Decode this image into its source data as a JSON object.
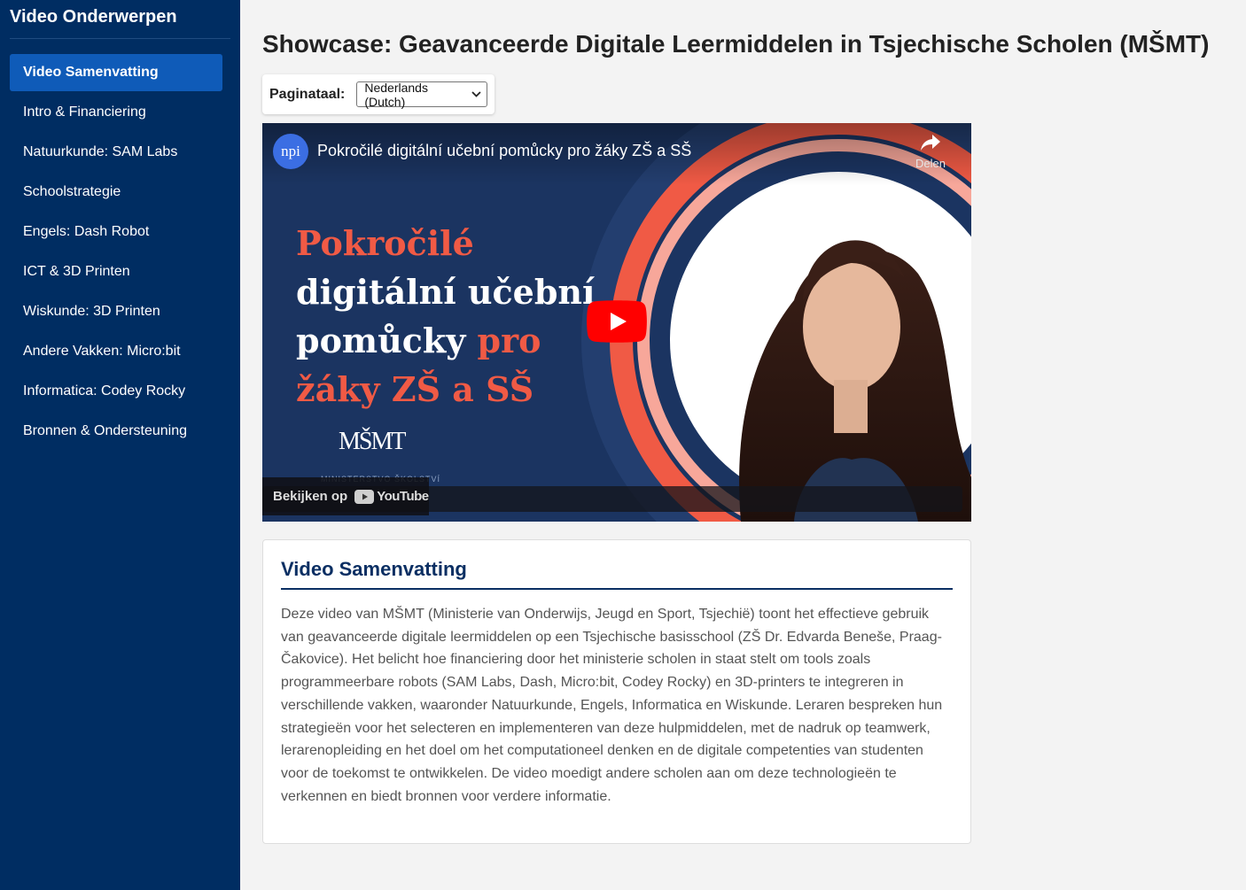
{
  "sidebar": {
    "title": "Video Onderwerpen",
    "items": [
      {
        "label": "Video Samenvatting",
        "active": true
      },
      {
        "label": "Intro & Financiering"
      },
      {
        "label": "Natuurkunde: SAM Labs"
      },
      {
        "label": "Schoolstrategie"
      },
      {
        "label": "Engels: Dash Robot"
      },
      {
        "label": "ICT & 3D Printen"
      },
      {
        "label": "Wiskunde: 3D Printen"
      },
      {
        "label": "Andere Vakken: Micro:bit"
      },
      {
        "label": "Informatica: Codey Rocky"
      },
      {
        "label": "Bronnen & Ondersteuning"
      }
    ]
  },
  "page": {
    "title": "Showcase: Geavanceerde Digitale Leermiddelen in Tsjechische Scholen (MŠMT)"
  },
  "language": {
    "label": "Paginataal:",
    "selected": "Nederlands (Dutch)"
  },
  "video": {
    "channel_avatar_text": "npi",
    "title": "Pokročilé digitální učební pomůcky pro žáky ZŠ a SŠ",
    "share_label": "Delen",
    "thumbnail_line1": "Pokročilé",
    "thumbnail_line2": "digitální učební",
    "thumbnail_line3a": "pomůcky",
    "thumbnail_line3b": "pro",
    "thumbnail_line4": "žáky ZŠ a SŠ",
    "logo_text": "MŠMT",
    "logo_subtext": "MINISTERSTVO ŠKOLSTVÍ",
    "watch_on": "Bekijken op",
    "youtube_label": "YouTube"
  },
  "summary": {
    "heading": "Video Samenvatting",
    "text": "Deze video van MŠMT (Ministerie van Onderwijs, Jeugd en Sport, Tsjechië) toont het effectieve gebruik van geavanceerde digitale leermiddelen op een Tsjechische basisschool (ZŠ Dr. Edvarda Beneše, Praag-Čakovice). Het belicht hoe financiering door het ministerie scholen in staat stelt om tools zoals programmeerbare robots (SAM Labs, Dash, Micro:bit, Codey Rocky) en 3D-printers te integreren in verschillende vakken, waaronder Natuurkunde, Engels, Informatica en Wiskunde. Leraren bespreken hun strategieën voor het selecteren en implementeren van deze hulpmiddelen, met de nadruk op teamwerk, lerarenopleiding en het doel om het computationeel denken en de digitale competenties van studenten voor de toekomst te ontwikkelen. De video moedigt andere scholen aan om deze technologieën te verkennen en biedt bronnen voor verdere informatie."
  },
  "colors": {
    "sidebar_bg": "#002d62",
    "nav_active": "#0f5bb8",
    "heading_blue": "#0b2f63",
    "thumbnail_accent": "#f05a45",
    "youtube_red": "#ff0000"
  }
}
